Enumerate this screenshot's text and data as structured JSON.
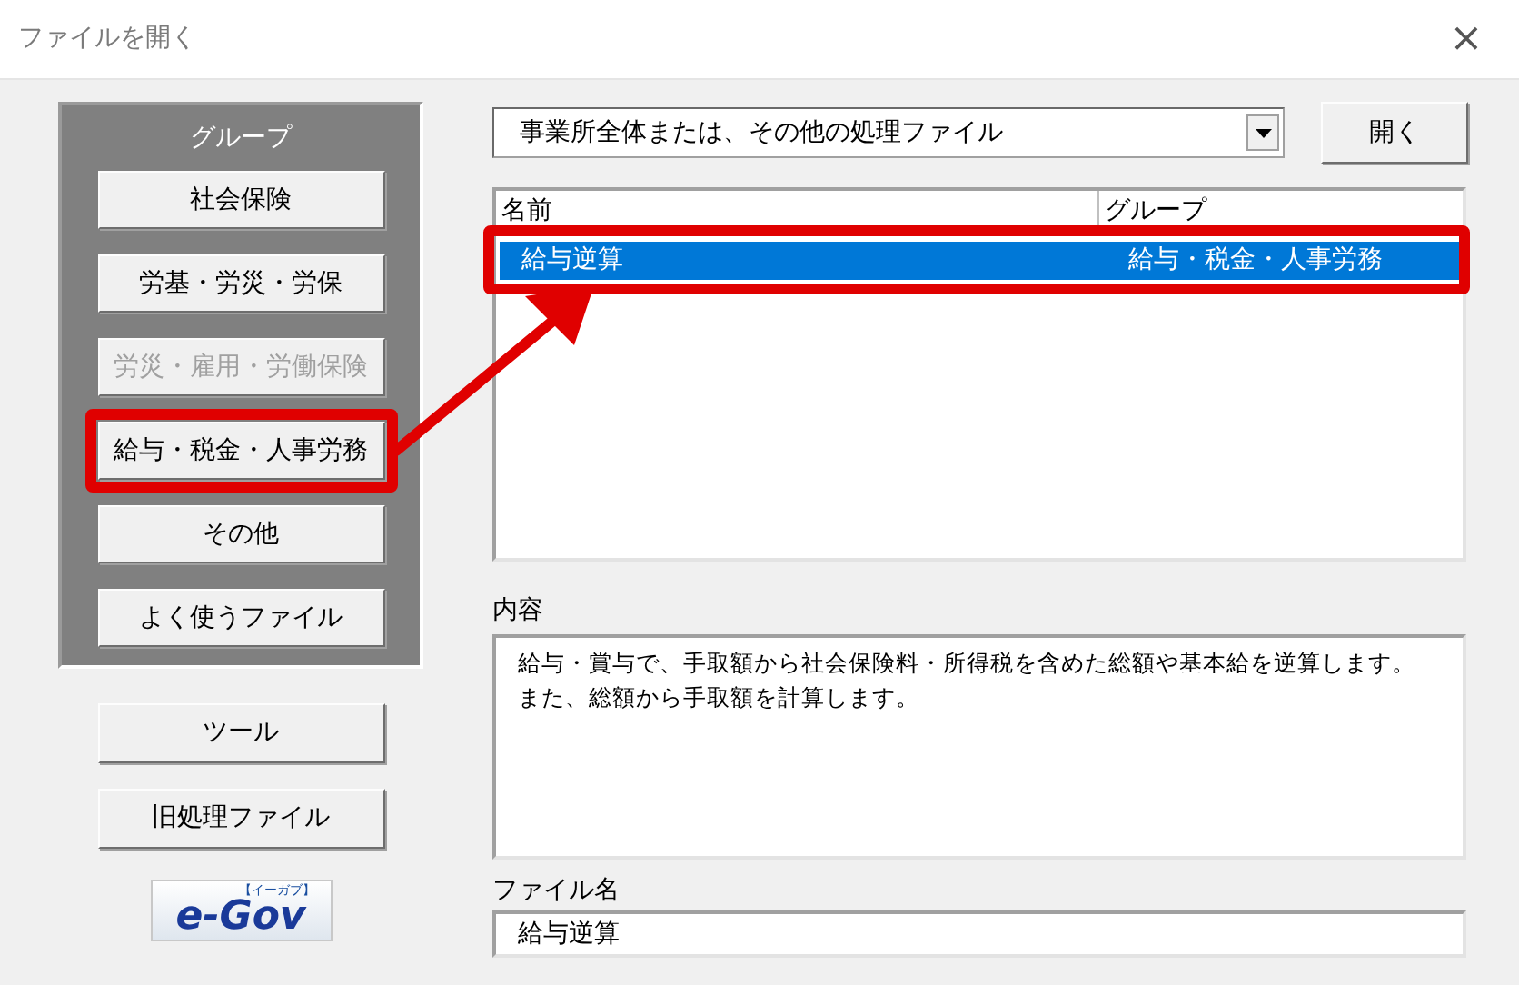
{
  "window": {
    "title": "ファイルを開く",
    "close": "×"
  },
  "group_panel": {
    "title": "グループ",
    "buttons": [
      {
        "label": "社会保険",
        "disabled": false,
        "highlighted": false
      },
      {
        "label": "労基・労災・労保",
        "disabled": false,
        "highlighted": false
      },
      {
        "label": "労災・雇用・労働保険",
        "disabled": true,
        "highlighted": false
      },
      {
        "label": "給与・税金・人事労務",
        "disabled": false,
        "highlighted": true
      },
      {
        "label": "その他",
        "disabled": false,
        "highlighted": false
      },
      {
        "label": "よく使うファイル",
        "disabled": false,
        "highlighted": false
      }
    ]
  },
  "side_buttons": [
    "ツール",
    "旧処理ファイル"
  ],
  "logo": {
    "text": "e-Gov",
    "tag": "【イーガブ】"
  },
  "file_type": {
    "value": "事業所全体または、その他の処理ファイル"
  },
  "open_button": "開く",
  "file_list": {
    "columns": [
      "名前",
      "グループ"
    ],
    "rows": [
      {
        "name": "給与逆算",
        "group": "給与・税金・人事労務",
        "selected": true,
        "highlighted": true
      }
    ]
  },
  "description": {
    "label": "内容",
    "lines": [
      "給与・賞与で、手取額から社会保険料・所得税を含めた総額や基本給を逆算します。",
      "また、総額から手取額を計算します。"
    ]
  },
  "file_name": {
    "label": "ファイル名",
    "value": "給与逆算"
  },
  "annotation_arrow": true
}
